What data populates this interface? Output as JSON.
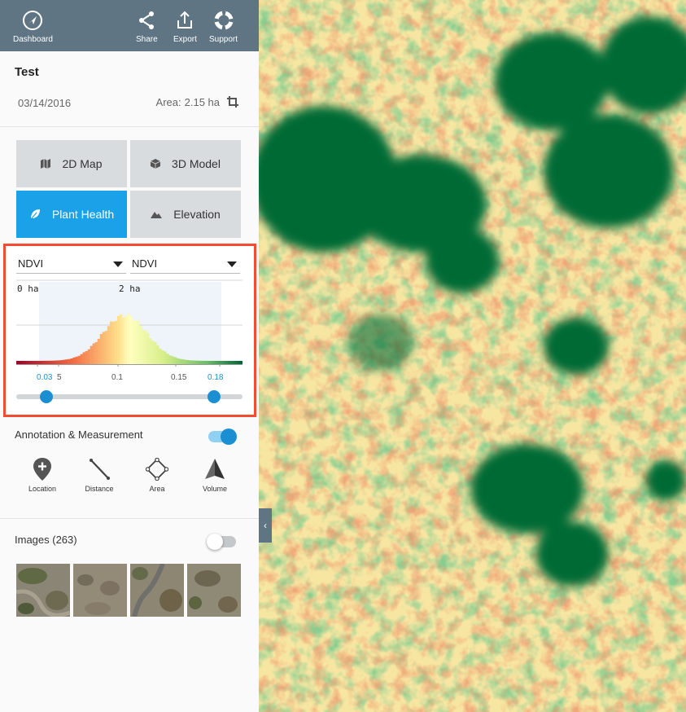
{
  "topbar": {
    "dashboard_label": "Dashboard",
    "share_label": "Share",
    "export_label": "Export",
    "support_label": "Support"
  },
  "project": {
    "title": "Test",
    "date": "03/14/2016",
    "area_label": "Area:",
    "area_value": "2.15 ha"
  },
  "views": [
    {
      "label": "2D Map",
      "icon": "map-icon",
      "active": false
    },
    {
      "label": "3D Model",
      "icon": "cube-icon",
      "active": false
    },
    {
      "label": "Plant Health",
      "icon": "leaf-icon",
      "active": true
    },
    {
      "label": "Elevation",
      "icon": "mountain-icon",
      "active": false
    }
  ],
  "plant_health": {
    "index_select": "NDVI",
    "colormap_select": "NDVI",
    "hist_min_label": "0 ha",
    "hist_mid_label": "2 ha",
    "ticks": [
      {
        "text": "0.03",
        "highlighted": true
      },
      {
        "text": "5",
        "highlighted": false
      },
      {
        "text": "0.1",
        "highlighted": false
      },
      {
        "text": "0.15",
        "highlighted": false
      },
      {
        "text": "0.18",
        "highlighted": true
      }
    ],
    "range_min": 0.03,
    "range_max": 0.18,
    "accent_color": "#1b8fd2"
  },
  "annotation": {
    "label": "Annotation & Measurement",
    "enabled": true,
    "tools": [
      {
        "label": "Location",
        "icon": "location-pin-icon"
      },
      {
        "label": "Distance",
        "icon": "distance-line-icon"
      },
      {
        "label": "Area",
        "icon": "area-polygon-icon"
      },
      {
        "label": "Volume",
        "icon": "volume-cone-icon"
      }
    ]
  },
  "images": {
    "label": "Images (263)",
    "enabled": false
  },
  "colors": {
    "topbar": "#5f7584",
    "active_button": "#1ba1e8",
    "highlight_border": "#f24d33",
    "ndvi_high": "#066a36",
    "ndvi_low": "#d8482a"
  }
}
